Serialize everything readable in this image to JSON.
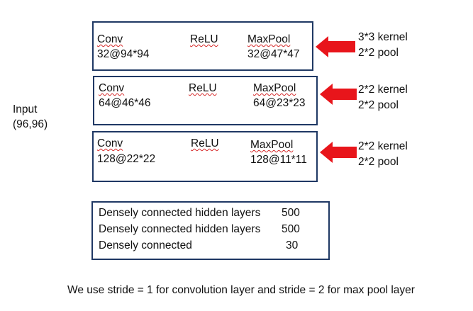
{
  "input": {
    "line1": "Input",
    "line2": "(96,96)"
  },
  "blocks": [
    {
      "conv": "Conv",
      "conv_dims": "32@94*94",
      "relu": "ReLU",
      "pool": "MaxPool",
      "pool_dims": "32@47*47",
      "note1": "3*3 kernel",
      "note2": "2*2 pool"
    },
    {
      "conv": "Conv",
      "conv_dims": "64@46*46",
      "relu": "ReLU",
      "pool": "MaxPool",
      "pool_dims": "64@23*23",
      "note1": "2*2 kernel",
      "note2": "2*2 pool"
    },
    {
      "conv": "Conv",
      "conv_dims": "128@22*22",
      "relu": "ReLU",
      "pool": "MaxPool",
      "pool_dims": "128@11*11",
      "note1": "2*2 kernel",
      "note2": "2*2 pool"
    }
  ],
  "dense": [
    {
      "label": "Densely connected hidden layers",
      "units": "500"
    },
    {
      "label": "Densely connected hidden layers",
      "units": "500"
    },
    {
      "label": "Densely connected",
      "units": "30"
    }
  ],
  "footnote": "We use stride = 1 for convolution layer and stride = 2 for max pool layer",
  "colors": {
    "box_border": "#1f3864",
    "arrow": "#e8151b",
    "text": "#111111"
  }
}
